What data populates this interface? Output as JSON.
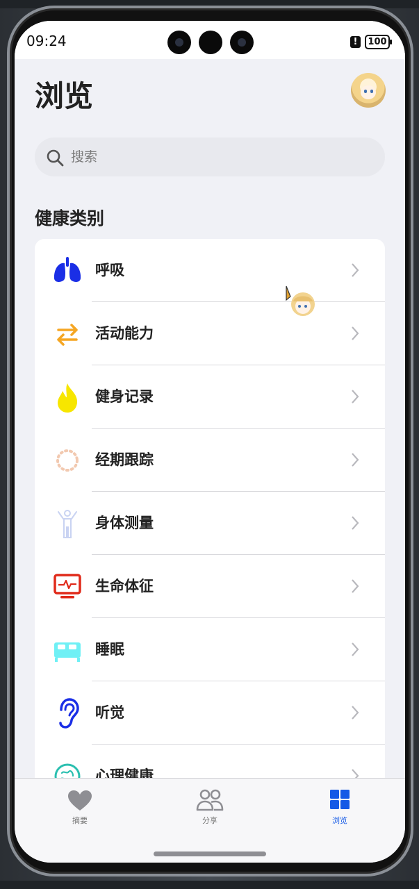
{
  "status_bar": {
    "time": "09:24",
    "battery": "100",
    "alert": "!"
  },
  "header": {
    "title": "浏览",
    "avatar": "user-avatar"
  },
  "search": {
    "placeholder": "搜索"
  },
  "section": {
    "title": "健康类别"
  },
  "categories": [
    {
      "label": "呼吸",
      "icon": "lungs-icon",
      "color": "#1a2ee6"
    },
    {
      "label": "活动能力",
      "icon": "arrows-swap-icon",
      "color": "#f5a623"
    },
    {
      "label": "健身记录",
      "icon": "flame-icon",
      "color": "#f7e600"
    },
    {
      "label": "经期跟踪",
      "icon": "dotted-circle-icon",
      "color": "#f2c9b0"
    },
    {
      "label": "身体测量",
      "icon": "body-figure-icon",
      "color": "#c9d3f2"
    },
    {
      "label": "生命体征",
      "icon": "vital-monitor-icon",
      "color": "#e02a1a"
    },
    {
      "label": "睡眠",
      "icon": "bed-icon",
      "color": "#6ff0f5"
    },
    {
      "label": "听觉",
      "icon": "ear-icon",
      "color": "#1a2ee6"
    },
    {
      "label": "心理健康",
      "icon": "brain-icon",
      "color": "#2bbfb0"
    }
  ],
  "tabbar": {
    "tabs": [
      {
        "label": "摘要",
        "icon": "heart-icon"
      },
      {
        "label": "分享",
        "icon": "people-icon"
      },
      {
        "label": "浏览",
        "icon": "grid-icon",
        "active": true
      }
    ],
    "active_color": "#1459e6"
  }
}
